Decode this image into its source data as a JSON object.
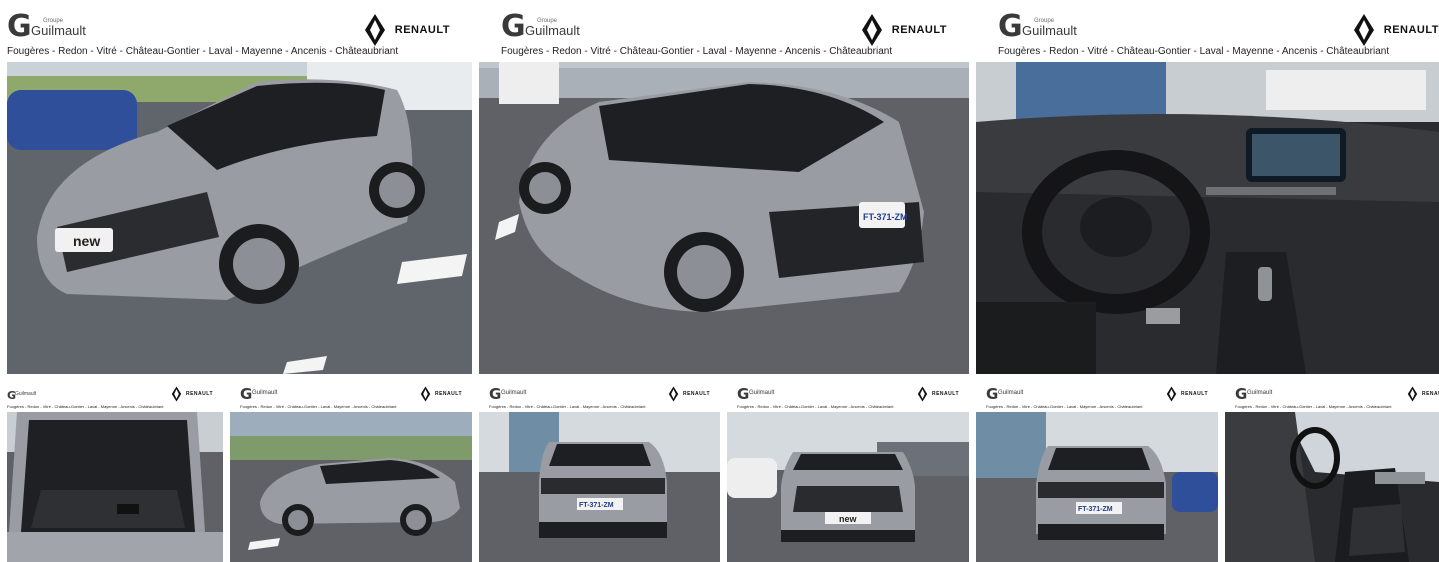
{
  "branding": {
    "group_small": "Groupe",
    "group_name": "Guilmault",
    "group_letter": "G",
    "brand": "RENAULT",
    "cities": "Fougères - Redon - Vitré - Château-Gontier - Laval - Mayenne - Ancenis - Châteaubriant"
  },
  "plate": "FT-371-ZM",
  "badge": "new",
  "colors": {
    "car_body": "#9a9ca3",
    "roof": "#1a1a1c",
    "asphalt": "#5f6166",
    "sky": "#d9dde2",
    "interior": "#2a2b2e"
  },
  "photos": [
    {
      "view": "front-three-quarter"
    },
    {
      "view": "rear-three-quarter"
    },
    {
      "view": "dashboard"
    },
    {
      "view": "trunk"
    },
    {
      "view": "side"
    },
    {
      "view": "rear"
    },
    {
      "view": "front"
    },
    {
      "view": "rear"
    },
    {
      "view": "front-seats"
    }
  ]
}
